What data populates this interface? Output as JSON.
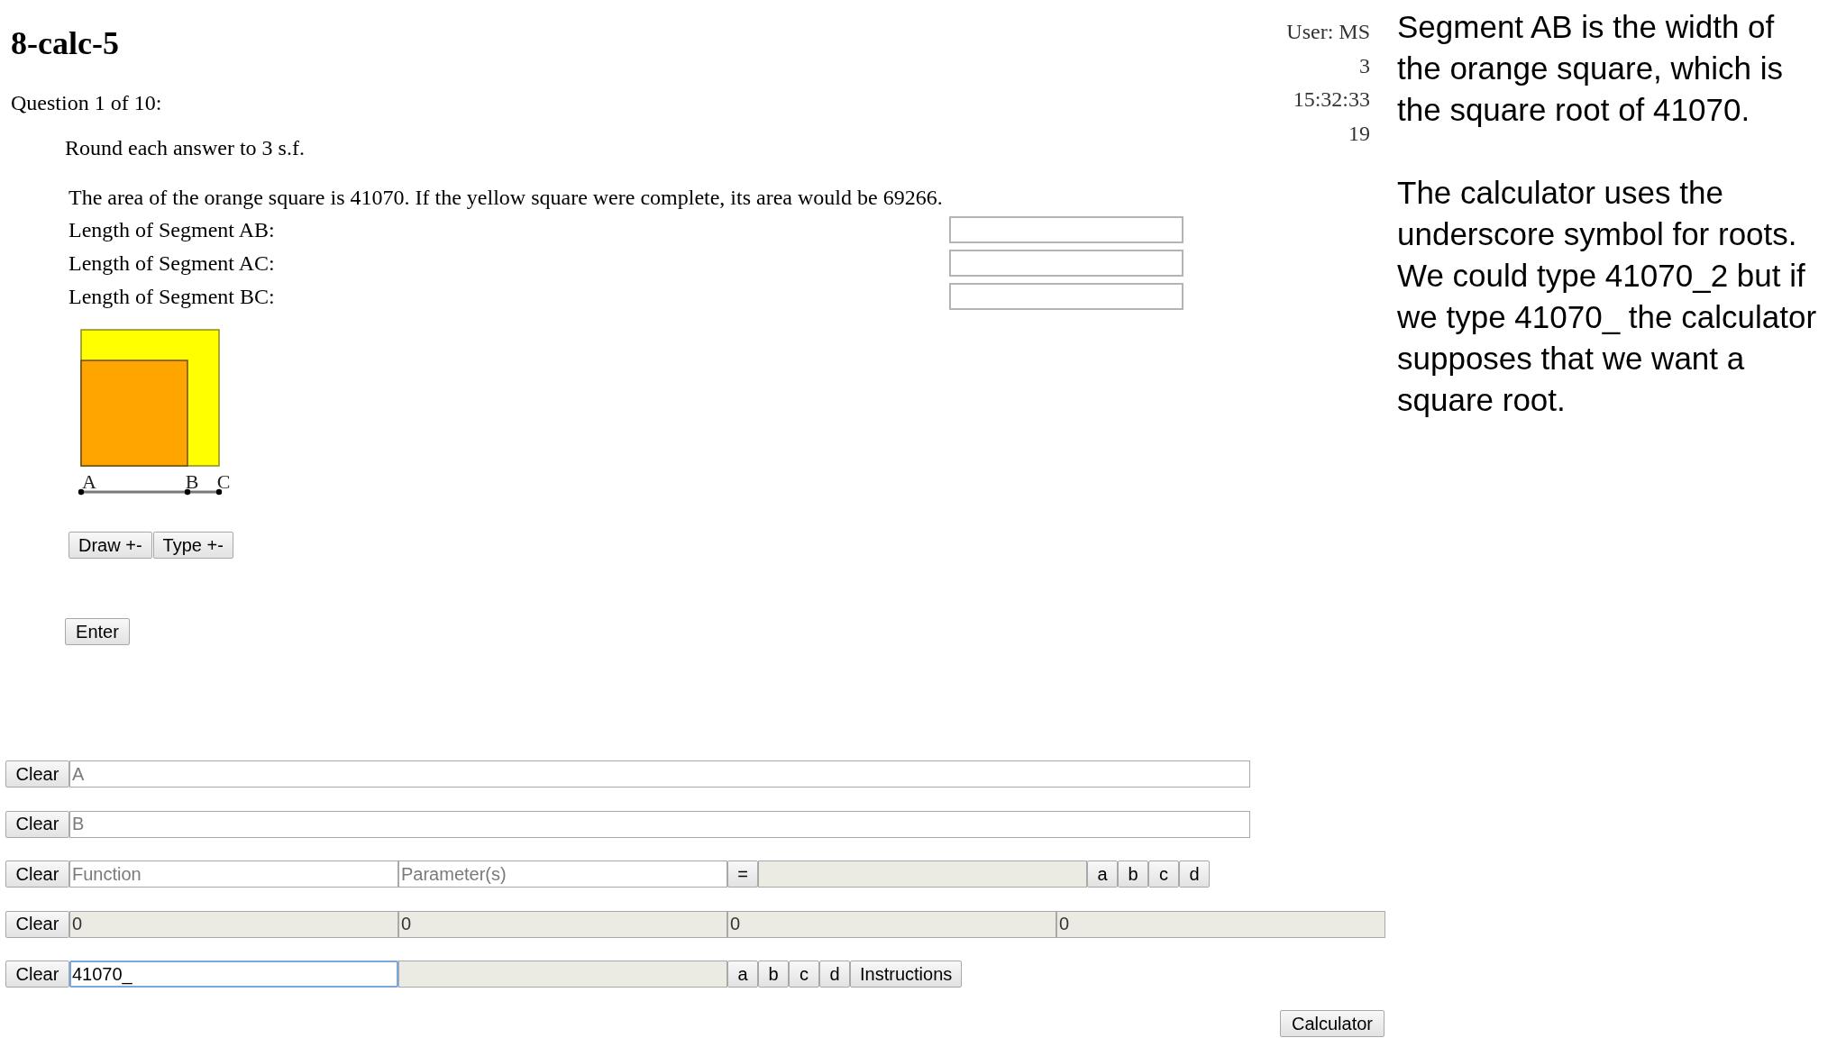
{
  "header": {
    "title": "8-calc-5",
    "question_counter": "Question 1 of 10:"
  },
  "status": {
    "user": "User: MS",
    "lines": [
      "3",
      "15:32:33",
      "19"
    ]
  },
  "instruction": "Round each answer to 3 s.f.",
  "question": {
    "text": "The area of the orange square is 41070. If the yellow square were complete, its area would be 69266.",
    "answers": [
      {
        "label": "Length of Segment AB:"
      },
      {
        "label": "Length of Segment AC:"
      },
      {
        "label": "Length of Segment BC:"
      }
    ],
    "diagram": {
      "squares": [
        {
          "color": "#ffff00"
        },
        {
          "color": "#ffa500"
        }
      ],
      "points": [
        {
          "label": "A"
        },
        {
          "label": "B"
        },
        {
          "label": "C"
        }
      ]
    }
  },
  "toggle_buttons": [
    "Draw +-",
    "Type +-"
  ],
  "enter_button": "Enter",
  "calculator": {
    "rows": [
      {
        "clear": "Clear",
        "cells": [
          {
            "kind": "wide-input",
            "placeholder": "A",
            "focused": false
          }
        ]
      },
      {
        "clear": "Clear",
        "cells": [
          {
            "kind": "wide-input",
            "placeholder": "B",
            "focused": false
          }
        ]
      },
      {
        "clear": "Clear",
        "cells": [
          {
            "kind": "input",
            "placeholder": "Function",
            "focused": false
          },
          {
            "kind": "input",
            "placeholder": "Parameter(s)",
            "focused": false
          },
          {
            "kind": "button",
            "label": "="
          },
          {
            "kind": "output"
          },
          {
            "kind": "button",
            "label": "a"
          },
          {
            "kind": "button",
            "label": "b"
          },
          {
            "kind": "button",
            "label": "c"
          },
          {
            "kind": "button",
            "label": "d"
          }
        ]
      },
      {
        "clear": "Clear",
        "cells": [
          {
            "kind": "output",
            "value": "0"
          },
          {
            "kind": "output",
            "value": "0"
          },
          {
            "kind": "output",
            "value": "0"
          },
          {
            "kind": "output",
            "value": "0"
          }
        ]
      },
      {
        "clear": "Clear",
        "cells": [
          {
            "kind": "input",
            "value": "41070_",
            "focused": true
          },
          {
            "kind": "output"
          },
          {
            "kind": "button",
            "label": "a"
          },
          {
            "kind": "button",
            "label": "b"
          },
          {
            "kind": "button",
            "label": "c"
          },
          {
            "kind": "button",
            "label": "d"
          },
          {
            "kind": "button",
            "label": "Instructions"
          }
        ]
      }
    ],
    "button": "Calculator"
  },
  "notes": {
    "paragraphs": [
      "Segment AB is the width of\nthe orange square, which is\nthe square root of 41070.",
      "The calculator uses the\nunderscore symbol for roots.\nWe could type 41070_2 but if\nwe type 41070_ the calculator\nsupposes that we want a\nsquare root."
    ]
  }
}
